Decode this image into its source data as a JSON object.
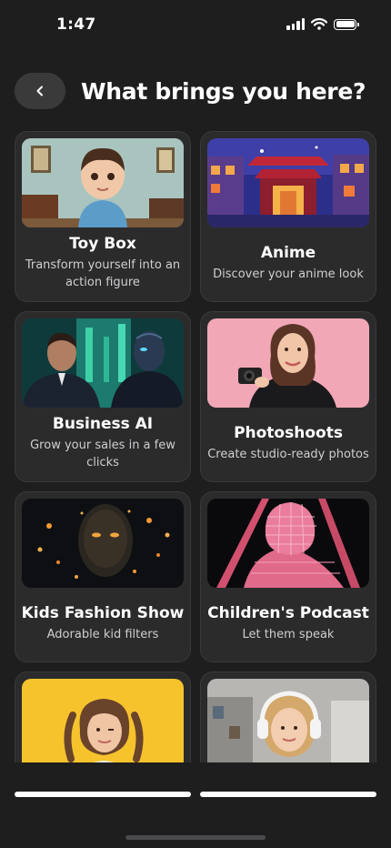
{
  "status": {
    "time": "1:47",
    "icons": [
      "cellular-signal-icon",
      "wifi-icon",
      "battery-icon"
    ]
  },
  "header": {
    "back_icon": "chevron-left-icon",
    "title": "What brings you here?"
  },
  "cards": [
    {
      "title": "Toy Box",
      "subtitle": "Transform yourself into an action figure",
      "image": "toy-figure-boy-photo"
    },
    {
      "title": "Anime",
      "subtitle": "Discover your anime look",
      "image": "anime-temple-illustration"
    },
    {
      "title": "Business AI",
      "subtitle": "Grow your sales in a few clicks",
      "image": "businessman-and-robot-photo"
    },
    {
      "title": "Photoshoots",
      "subtitle": "Create studio-ready photos",
      "image": "woman-with-camera-photo"
    },
    {
      "title": "Kids Fashion Show",
      "subtitle": "Adorable kid filters",
      "image": "glowing-particle-face-photo"
    },
    {
      "title": "Children's Podcast",
      "subtitle": "Let them speak",
      "image": "neon-wireframe-figure-photo"
    },
    {
      "title": "",
      "subtitle": "",
      "image": "girl-on-yellow-photo"
    },
    {
      "title": "",
      "subtitle": "",
      "image": "girl-with-headphones-photo"
    }
  ],
  "colors": {
    "background": "#1e1e1f",
    "card": "#2b2b2c",
    "card_border": "#3a3a3b",
    "back_button": "#3a3a3b"
  }
}
